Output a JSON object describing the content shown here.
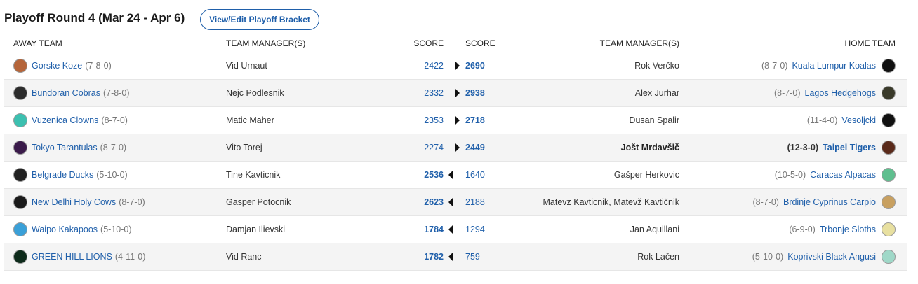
{
  "title": "Playoff Round 4 (Mar 24 - Apr 6)",
  "bracket_button": "View/Edit Playoff Bracket",
  "headers": {
    "away_team": "AWAY TEAM",
    "away_manager": "TEAM MANAGER(S)",
    "away_score": "SCORE",
    "home_score": "SCORE",
    "home_manager": "TEAM MANAGER(S)",
    "home_team": "HOME TEAM"
  },
  "colors": {
    "link": "#1f5faa",
    "record": "#777777",
    "row_alt": "#f4f4f4"
  },
  "matchups": [
    {
      "away": {
        "team": "Gorske Koze",
        "record": "(7-8-0)",
        "manager": "Vid Urnaut",
        "score": "2422",
        "logo": "goat-avatar-icon",
        "logo_color": "#b5653a"
      },
      "home": {
        "team": "Kuala Lumpur Koalas",
        "record": "(8-7-0)",
        "manager": "Rok Verčko",
        "score": "2690",
        "logo": "koala-avatar-icon",
        "logo_color": "#111111"
      },
      "winner": "home"
    },
    {
      "away": {
        "team": "Bundoran Cobras",
        "record": "(7-8-0)",
        "manager": "Nejc Podlesnik",
        "score": "2332",
        "logo": "cobra-avatar-icon",
        "logo_color": "#2c2c2c"
      },
      "home": {
        "team": "Lagos Hedgehogs",
        "record": "(8-7-0)",
        "manager": "Alex Jurhar",
        "score": "2938",
        "logo": "hedgehog-avatar-icon",
        "logo_color": "#3a3a2a"
      },
      "winner": "home"
    },
    {
      "away": {
        "team": "Vuzenica Clowns",
        "record": "(8-7-0)",
        "manager": "Matic Maher",
        "score": "2353",
        "logo": "clown-avatar-icon",
        "logo_color": "#3cc0b0"
      },
      "home": {
        "team": "Vesoljcki",
        "record": "(11-4-0)",
        "manager": "Dusan Spalir",
        "score": "2718",
        "logo": "astronaut-avatar-icon",
        "logo_color": "#111111"
      },
      "winner": "home"
    },
    {
      "away": {
        "team": "Tokyo Tarantulas",
        "record": "(8-7-0)",
        "manager": "Vito Torej",
        "score": "2274",
        "logo": "tarantula-avatar-icon",
        "logo_color": "#3a1a4a"
      },
      "home": {
        "team": "Taipei Tigers",
        "record": "(12-3-0)",
        "manager": "Jošt Mrdavšič",
        "score": "2449",
        "logo": "tiger-avatar-icon",
        "logo_color": "#5a2a1a"
      },
      "winner": "home",
      "highlight_home": true
    },
    {
      "away": {
        "team": "Belgrade Ducks",
        "record": "(5-10-0)",
        "manager": "Tine Kavticnik",
        "score": "2536",
        "logo": "duck-avatar-icon",
        "logo_color": "#222222"
      },
      "home": {
        "team": "Caracas Alpacas",
        "record": "(10-5-0)",
        "manager": "Gašper Herkovic",
        "score": "1640",
        "logo": "alpaca-avatar-icon",
        "logo_color": "#5fbf8f"
      },
      "winner": "away"
    },
    {
      "away": {
        "team": "New Delhi Holy Cows",
        "record": "(8-7-0)",
        "manager": "Gasper Potocnik",
        "score": "2623",
        "logo": "cow-avatar-icon",
        "logo_color": "#1a1a1a"
      },
      "home": {
        "team": "Brdinje Cyprinus Carpio",
        "record": "(8-7-0)",
        "manager": "Matevz Kavticnik, Matevž Kavtičnik",
        "score": "2188",
        "logo": "carp-avatar-icon",
        "logo_color": "#c8a060"
      },
      "winner": "away"
    },
    {
      "away": {
        "team": "Waipo Kakapoos",
        "record": "(5-10-0)",
        "manager": "Damjan Ilievski",
        "score": "1784",
        "logo": "kakapo-avatar-icon",
        "logo_color": "#3aa0d8"
      },
      "home": {
        "team": "Trbonje Sloths",
        "record": "(6-9-0)",
        "manager": "Jan Aquillani",
        "score": "1294",
        "logo": "sloth-avatar-icon",
        "logo_color": "#e8e0a0"
      },
      "winner": "away"
    },
    {
      "away": {
        "team": "GREEN HILL LIONS",
        "record": "(4-11-0)",
        "manager": "Vid Ranc",
        "score": "1782",
        "logo": "lion-avatar-icon",
        "logo_color": "#0d2a1a"
      },
      "home": {
        "team": "Koprivski Black Angusi",
        "record": "(5-10-0)",
        "manager": "Rok Lačen",
        "score": "759",
        "logo": "bull-avatar-icon",
        "logo_color": "#9fd8c8"
      },
      "winner": "away"
    }
  ]
}
